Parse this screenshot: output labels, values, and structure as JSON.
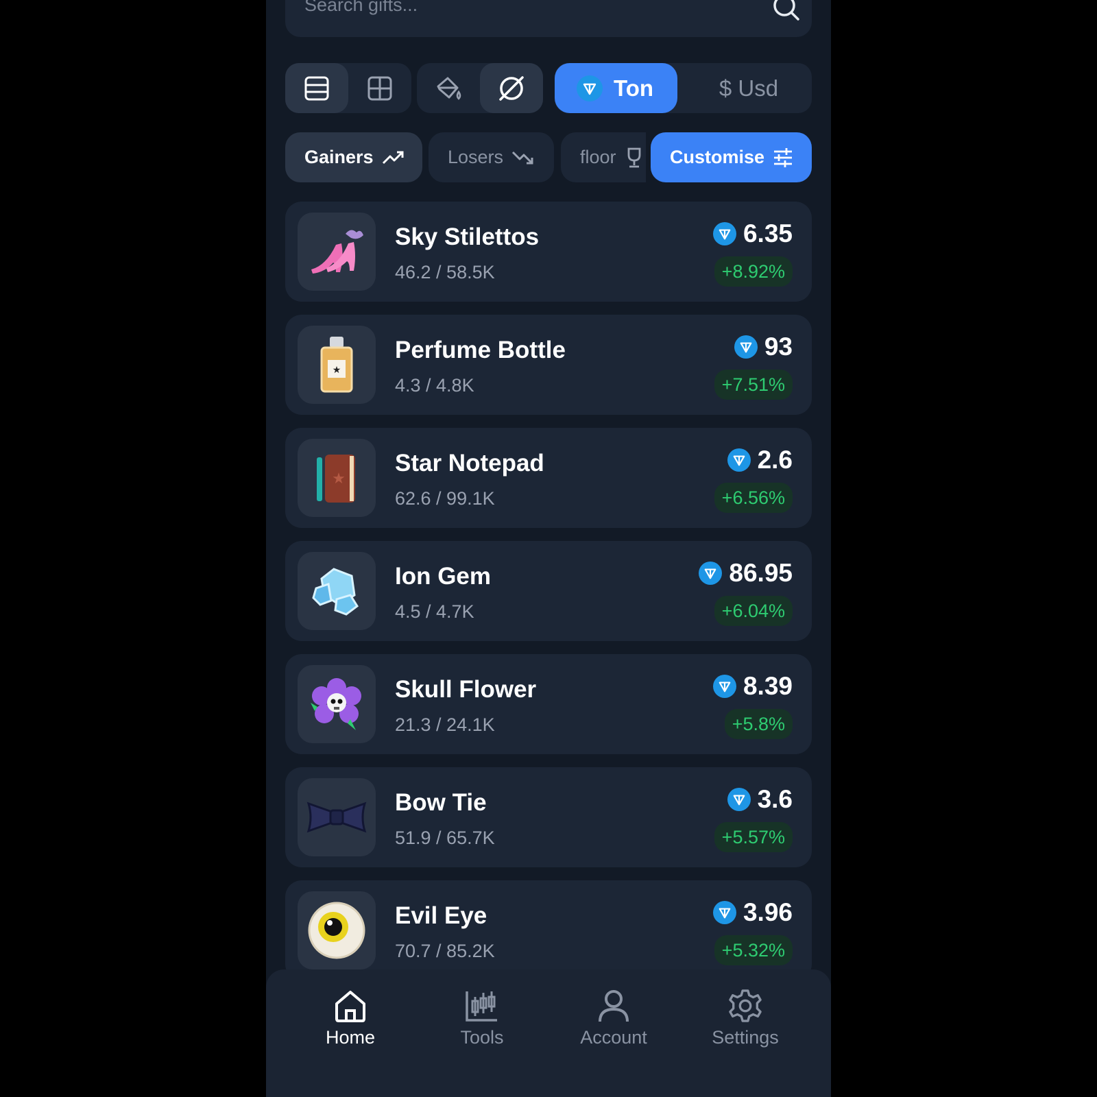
{
  "search": {
    "placeholder": "Search gifts..."
  },
  "currency": {
    "ton_label": "Ton",
    "usd_label": "$ Usd"
  },
  "filters": {
    "gainers": "Gainers",
    "losers": "Losers",
    "floor": "floor",
    "customise": "Customise"
  },
  "colors": {
    "accent": "#3b82f6",
    "positive": "#2ecc71",
    "ton": "#1e96e6",
    "background": "#121a26",
    "card": "#1c2636"
  },
  "gifts": [
    {
      "name": "Sky Stilettos",
      "supply": "46.2 / 58.5K",
      "price": "6.35",
      "change": "+8.92%",
      "icon": "stiletto-icon"
    },
    {
      "name": "Perfume Bottle",
      "supply": "4.3 / 4.8K",
      "price": "93",
      "change": "+7.51%",
      "icon": "perfume-icon"
    },
    {
      "name": "Star Notepad",
      "supply": "62.6 / 99.1K",
      "price": "2.6",
      "change": "+6.56%",
      "icon": "notepad-icon"
    },
    {
      "name": "Ion Gem",
      "supply": "4.5 / 4.7K",
      "price": "86.95",
      "change": "+6.04%",
      "icon": "gem-icon"
    },
    {
      "name": "Skull Flower",
      "supply": "21.3 / 24.1K",
      "price": "8.39",
      "change": "+5.8%",
      "icon": "skull-flower-icon"
    },
    {
      "name": "Bow Tie",
      "supply": "51.9 / 65.7K",
      "price": "3.6",
      "change": "+5.57%",
      "icon": "bow-tie-icon"
    },
    {
      "name": "Evil Eye",
      "supply": "70.7 / 85.2K",
      "price": "3.96",
      "change": "+5.32%",
      "icon": "evil-eye-icon"
    }
  ],
  "nav": {
    "home": "Home",
    "tools": "Tools",
    "account": "Account",
    "settings": "Settings"
  }
}
